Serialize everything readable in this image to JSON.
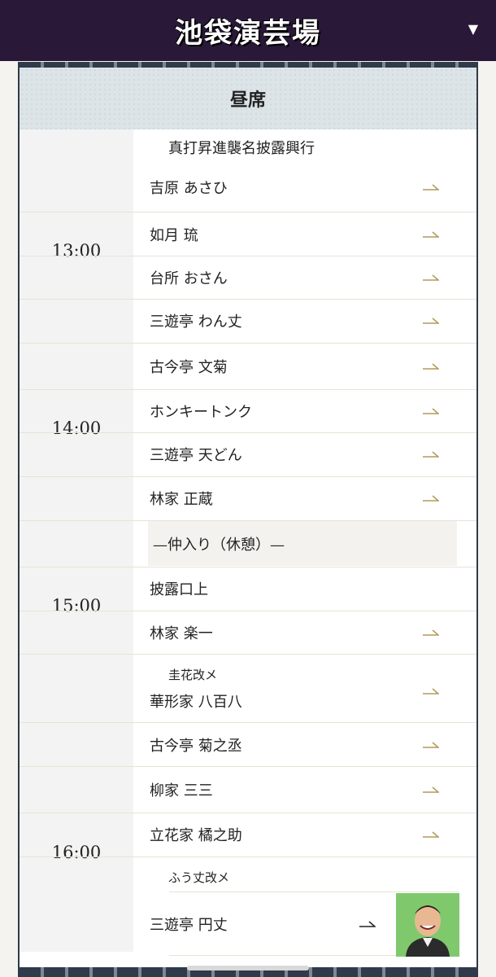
{
  "header": {
    "title": "池袋演芸場",
    "menu_icon": "▼"
  },
  "section": {
    "title": "昼席"
  },
  "times": [
    "13:00",
    "14:00",
    "15:00",
    "16:00"
  ],
  "program": {
    "headline": "真打昇進襲名披露興行",
    "performers": [
      "吉原 あさひ",
      "如月 琉",
      "台所 おさん",
      "三遊亭 わん丈",
      "古今亭 文菊",
      "ホンキートンク",
      "三遊亭 天どん",
      "林家 正蔵"
    ],
    "intermission": "—仲入り（休憩）—",
    "announcement": "披露口上",
    "performers_after": [
      "林家 楽一",
      "華形家 八百八",
      "古今亭 菊之丞",
      "柳家 三三",
      "立花家 橘之助",
      "三遊亭 円丈"
    ],
    "notes": {
      "keika": "圭花改メ",
      "fuujou": "ふう丈改メ"
    }
  },
  "colors": {
    "header_bg": "#2a1838",
    "accent_arrow": "#b39a5a",
    "section_bg": "#dce4e8"
  },
  "icons": {
    "arrow": "arrow-right-icon",
    "menu": "chevron-down-icon"
  }
}
